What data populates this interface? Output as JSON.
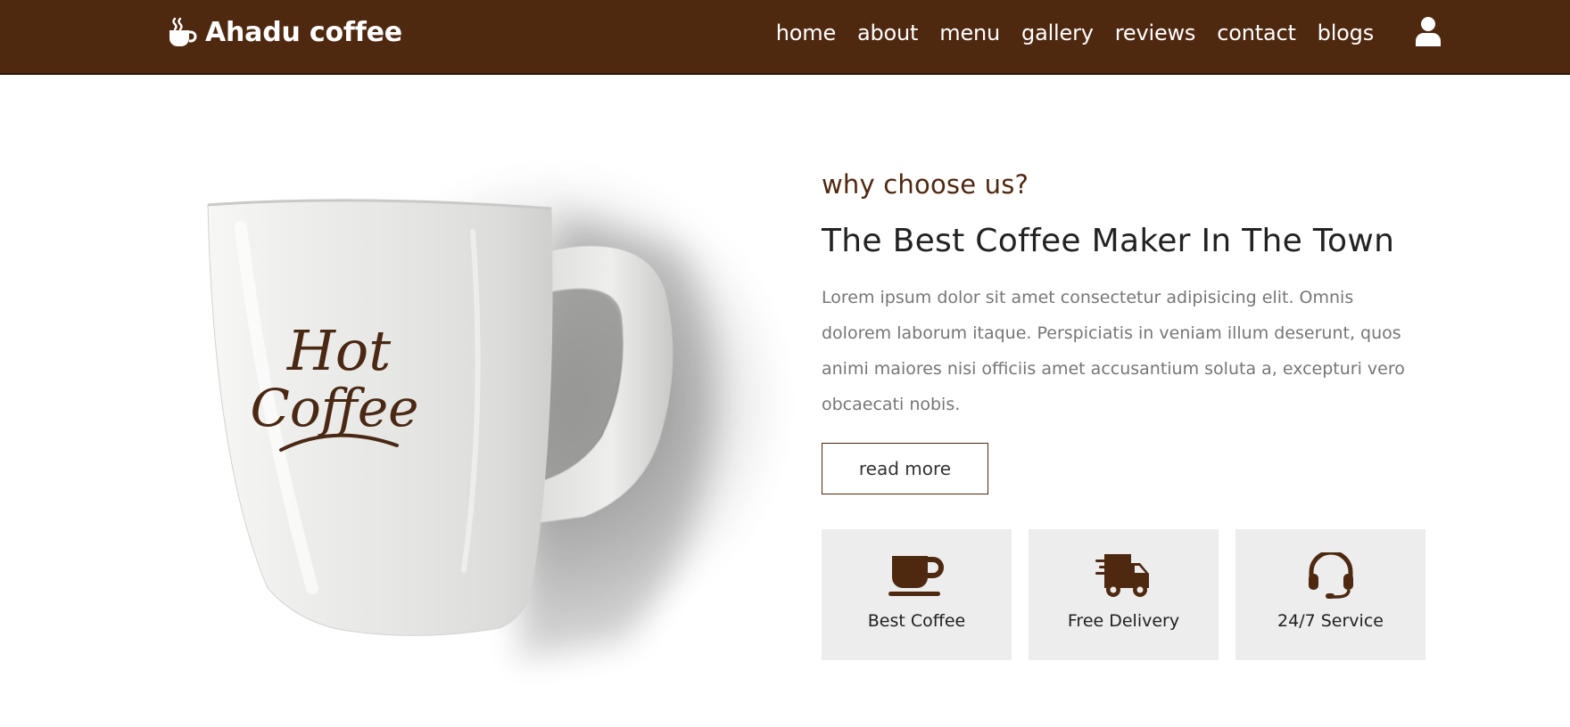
{
  "header": {
    "brand": "Ahadu coffee",
    "brand_icon": "coffee-cup-icon",
    "nav": [
      {
        "label": "home"
      },
      {
        "label": "about"
      },
      {
        "label": "menu"
      },
      {
        "label": "gallery"
      },
      {
        "label": "reviews"
      },
      {
        "label": "contact"
      },
      {
        "label": "blogs"
      }
    ],
    "user_icon": "user-icon",
    "background": "#4f2810"
  },
  "hero": {
    "image": "white-coffee-mug",
    "mug_text": "Hot Coffee"
  },
  "about": {
    "subtitle": "why choose us?",
    "title": "The Best Coffee Maker In The Town",
    "description": "Lorem ipsum dolor sit amet consectetur adipisicing elit. Omnis dolorem laborum itaque. Perspiciatis in veniam illum deserunt, quos animi maiores nisi officiis amet accusantium soluta a, excepturi vero obcaecati nobis.",
    "button": "read more",
    "features": [
      {
        "icon": "coffee-mug-icon",
        "label": "Best Coffee"
      },
      {
        "icon": "delivery-truck-icon",
        "label": "Free Delivery"
      },
      {
        "icon": "headset-icon",
        "label": "24/7 Service"
      }
    ]
  },
  "colors": {
    "primary": "#4f2810",
    "feature_bg": "#ededed",
    "text": "#222222",
    "muted": "#767676"
  }
}
